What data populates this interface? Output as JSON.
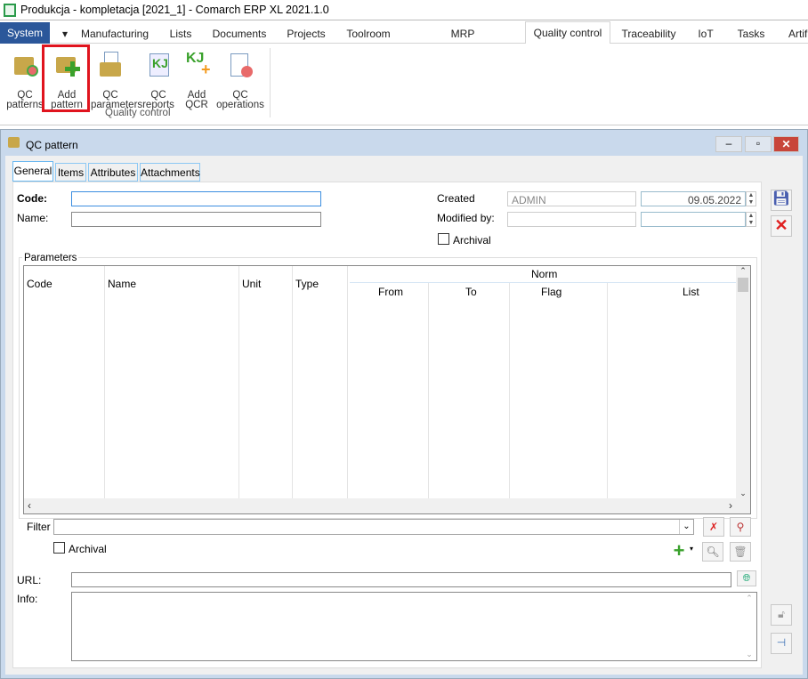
{
  "app": {
    "title": "Produkcja - kompletacja [2021_1] - Comarch ERP XL 2021.1.0"
  },
  "menu": {
    "system": "System",
    "tabs": [
      "Manufacturing",
      "Lists",
      "Documents",
      "Projects",
      "Toolroom",
      "MRP recommendations",
      "Quality control",
      "Traceability",
      "IoT",
      "Tasks",
      "Artif"
    ],
    "active": "Quality control"
  },
  "ribbon": {
    "group": "Quality control",
    "buttons": [
      {
        "line1": "QC",
        "line2": "patterns",
        "icon": "folder-check-icon"
      },
      {
        "line1": "Add",
        "line2": "pattern",
        "icon": "folder-add-icon"
      },
      {
        "line1": "QC",
        "line2": "parameters",
        "icon": "folder-list-icon"
      },
      {
        "line1": "QC",
        "line2": "reports",
        "icon": "report-icon"
      },
      {
        "line1": "Add",
        "line2": "QCR",
        "icon": "report-add-icon"
      },
      {
        "line1": "QC",
        "line2": "operations",
        "icon": "operations-icon"
      }
    ]
  },
  "window": {
    "title": "QC pattern",
    "tabs": [
      "General",
      "Items",
      "Attributes",
      "Attachments"
    ],
    "form": {
      "code_label": "Code:",
      "code_value": "",
      "name_label": "Name:",
      "name_value": "",
      "created_label": "Created",
      "created_by": "ADMIN",
      "created_date": "09.05.2022",
      "modified_label": "Modified by:",
      "modified_by": "",
      "modified_date": "",
      "archival_label": "Archival"
    },
    "parameters": {
      "legend": "Parameters",
      "columns": {
        "code": "Code",
        "name": "Name",
        "unit": "Unit",
        "type": "Type",
        "norm": "Norm",
        "from": "From",
        "to": "To",
        "flag": "Flag",
        "list": "List"
      },
      "rows": []
    },
    "filter": {
      "label": "Filter",
      "value": "",
      "archival_label": "Archival"
    },
    "url": {
      "label": "URL:",
      "value": ""
    },
    "info": {
      "label": "Info:",
      "value": ""
    }
  },
  "colors": {
    "system_tab": "#2b579a",
    "highlight": "#e0141e",
    "window_title": "#c9d9ec"
  }
}
